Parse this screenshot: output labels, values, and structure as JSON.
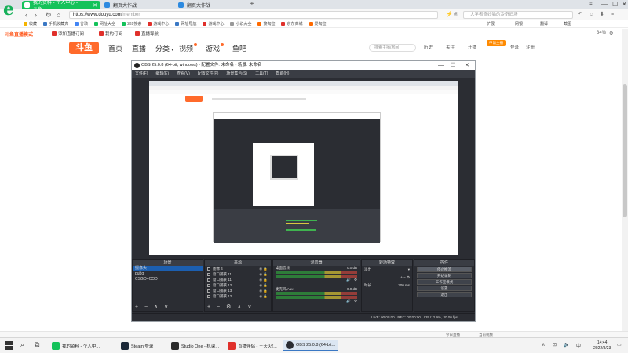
{
  "browser": {
    "tabs": [
      {
        "label": "我的资料 - 个人中心 - 斗鱼",
        "active": true
      },
      {
        "label": "翻页大作战",
        "active": false
      },
      {
        "label": "翻页大作战",
        "active": false
      }
    ],
    "url_host": "https://www.douyu.com",
    "url_path": "/member",
    "search_placeholder": "大学者奇妙猫的冷奇旧场",
    "bookmarks": [
      "收藏",
      "手机收藏夹",
      "谷歌",
      "网址大全",
      "360搜索",
      "游戏中心",
      "网址导航",
      "游戏中心",
      "小说大全",
      "搜淘宝",
      "京东商城",
      "爱淘宝"
    ],
    "bookmarks_right": [
      "扩展",
      "网银",
      "翻译",
      "截图"
    ],
    "brand_color": "#14c25a"
  },
  "douyu": {
    "top_logo": "斗鱼直播模式",
    "top_links": [
      "添加直播订阅",
      "我的订阅",
      "直播导航"
    ],
    "zoom": "34%",
    "nav": [
      "首页",
      "直播",
      "分类",
      "视频",
      "游戏",
      "鱼吧"
    ],
    "logo_text": "斗鱼",
    "search_placeholder": "搜索主播/房间",
    "right_links": [
      "历史",
      "关注",
      "开播",
      "登录",
      "注册"
    ],
    "start_live": "申请主播",
    "accent": "#ff6a2b"
  },
  "obs": {
    "title": "OBS 25.0.8 (64-bit, windows) - 配置文件: 未命名 - 场景: 未命名",
    "menu": [
      "文件(F)",
      "编辑(E)",
      "查看(V)",
      "配置文件(P)",
      "场景集合(S)",
      "工具(T)",
      "帮助(H)"
    ],
    "docks": {
      "scenes": {
        "header": "场景",
        "items": [
          "摄像头",
          "pubg",
          "CSGO+COD"
        ]
      },
      "sources": {
        "header": "来源",
        "items": [
          "图像 4",
          "窗口捕获 11",
          "窗口捕获 11",
          "窗口捕获 12",
          "窗口捕获 13",
          "窗口捕获 12"
        ]
      },
      "mixer": {
        "header": "混音器",
        "channels": [
          {
            "name": "桌面音频",
            "level": "0.0 dB"
          },
          {
            "name": "麦克风/Aux",
            "level": "0.0 dB"
          }
        ]
      },
      "transitions": {
        "header": "转场特效",
        "type": "淡出",
        "duration_label": "时长",
        "duration": "300 ms"
      },
      "controls": {
        "header": "控件",
        "buttons": [
          "停止推流",
          "开始录制",
          "工作室模式",
          "设置",
          "退出"
        ]
      }
    },
    "status": {
      "live": "LIVE: 00:00:00",
      "rec": "REC: 00:00:00",
      "cpu": "CPU: 2.9%, 30.00 fps"
    }
  },
  "page_status": [
    "今日直播",
    "当前视频"
  ],
  "taskbar": {
    "tasks": [
      {
        "label": "我的资料 - 个人中...",
        "color": "#14c25a"
      },
      {
        "label": "Steam 登录",
        "color": "#1b2838"
      },
      {
        "label": "Studio One - 机架...",
        "color": "#2a2a2a"
      },
      {
        "label": "直播伴侣 - 王天火(...",
        "color": "#e0302b"
      },
      {
        "label": "OBS 25.0.8 (64-bit...",
        "color": "#2b2d33",
        "active": true
      }
    ],
    "time": "14:44",
    "date": "2022/3/23"
  }
}
